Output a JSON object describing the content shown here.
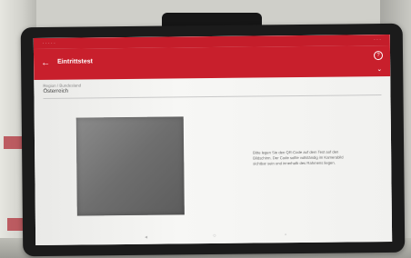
{
  "app": {
    "title": "Eintrittstest",
    "back_icon": "arrow-left-icon",
    "help_icon": "help-circle-icon",
    "help_glyph": "?",
    "chevron_icon": "chevron-down-icon"
  },
  "region": {
    "label": "Region / Bundesland",
    "value": "Österreich"
  },
  "instruction": {
    "text": "Bitte legen Sie den QR-Code auf dem Test auf den Bildschirm. Der Code sollte vollständig im Kamerabild sichtbar sein und innerhalb des Rahmens liegen."
  },
  "colors": {
    "toolbar": "#c81f2c",
    "screen_background": "#f4f4f2"
  }
}
